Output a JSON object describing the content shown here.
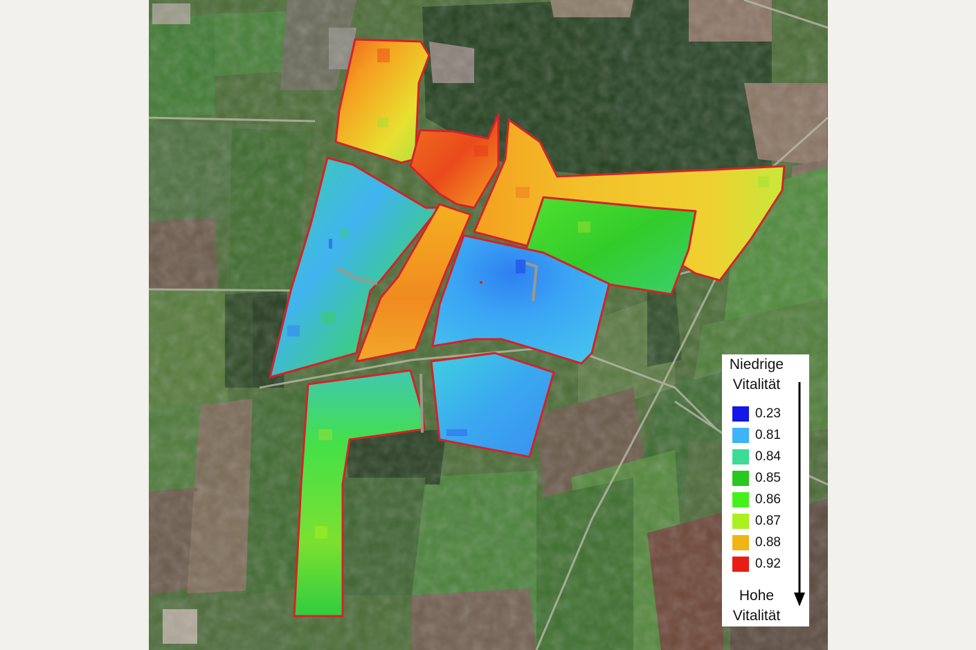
{
  "legend": {
    "low_label_line1": "Niedrige",
    "low_label_line2": "Vitalität",
    "high_label_line1": "Hohe",
    "high_label_line2": "Vitalität",
    "items": [
      {
        "value": "0.23",
        "color": "#1418e6"
      },
      {
        "value": "0.81",
        "color": "#3cb4f5"
      },
      {
        "value": "0.84",
        "color": "#3cdc96"
      },
      {
        "value": "0.85",
        "color": "#28c81e"
      },
      {
        "value": "0.86",
        "color": "#46f01e"
      },
      {
        "value": "0.87",
        "color": "#aaf01e"
      },
      {
        "value": "0.88",
        "color": "#f0b414"
      },
      {
        "value": "0.92",
        "color": "#e61e14"
      }
    ]
  },
  "map": {
    "boundary_color": "#d2232a",
    "fields": [
      {
        "id": "north-field",
        "vitality": "orange-yellow"
      },
      {
        "id": "center-north-field",
        "vitality": "orange-red"
      },
      {
        "id": "northeast-strip",
        "vitality": "yellow-orange"
      },
      {
        "id": "east-inner-field",
        "vitality": "green"
      },
      {
        "id": "west-field",
        "vitality": "blue-green"
      },
      {
        "id": "diagonal-strip",
        "vitality": "orange"
      },
      {
        "id": "central-field",
        "vitality": "blue"
      },
      {
        "id": "south-central-field",
        "vitality": "cyan-blue"
      },
      {
        "id": "south-l-field",
        "vitality": "green"
      }
    ]
  }
}
